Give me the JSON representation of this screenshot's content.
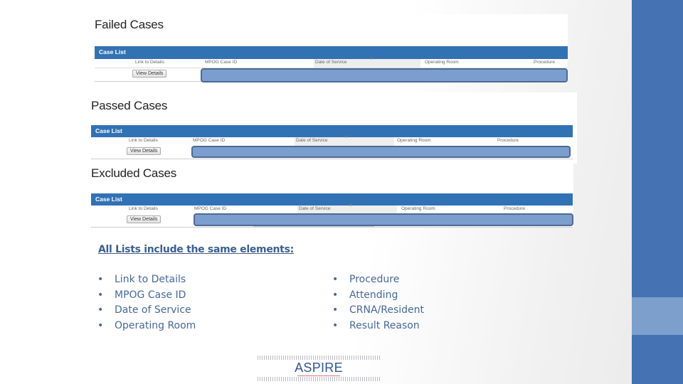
{
  "sections": [
    {
      "title": "Failed Cases",
      "panel_title": "Case List",
      "columns": [
        "Link to Details",
        "MPOG Case ID",
        "Date of Service",
        "Operating Room",
        "Procedure"
      ],
      "button_label": "View Details"
    },
    {
      "title": "Passed Cases",
      "panel_title": "Case List",
      "columns": [
        "Link to Details",
        "MPOG Case ID",
        "Date of Service",
        "Operating Room",
        "Procedure"
      ],
      "button_label": "View Details"
    },
    {
      "title": "Excluded Cases",
      "panel_title": "Case List",
      "columns": [
        "Link to Details",
        "MPOG Case ID",
        "Date of Service",
        "Operating Room",
        "Procedure"
      ],
      "button_label": "View Details"
    }
  ],
  "summary": {
    "heading": "All Lists include the same elements:",
    "bullet": "•",
    "left_items": [
      "Link to Details",
      "MPOG Case ID",
      "Date of Service",
      "Operating Room"
    ],
    "right_items": [
      "Procedure",
      "Attending",
      "CRNA/Resident",
      "Result Reason"
    ]
  },
  "logo": {
    "text": "ASPIRE"
  },
  "colors": {
    "brand_blue": "#4472b3",
    "panel_blue": "#3172b4",
    "mask_blue": "#7b9ecf",
    "text_blue": "#46689a"
  }
}
